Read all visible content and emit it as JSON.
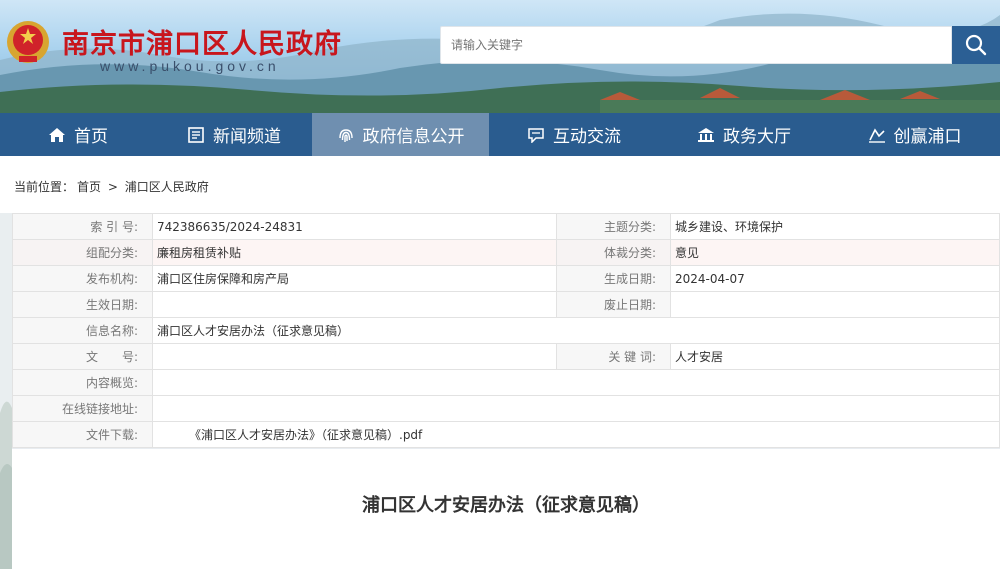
{
  "header": {
    "site_title": "南京市浦口区人民政府",
    "site_domain": "www.pukou.gov.cn",
    "search_placeholder": "请输入关键字"
  },
  "nav": {
    "items": [
      {
        "label": "首页",
        "icon": "home-icon"
      },
      {
        "label": "新闻频道",
        "icon": "news-icon"
      },
      {
        "label": "政府信息公开",
        "icon": "fingerprint-icon",
        "active": true
      },
      {
        "label": "互动交流",
        "icon": "chat-icon"
      },
      {
        "label": "政务大厅",
        "icon": "hall-icon"
      },
      {
        "label": "创赢浦口",
        "icon": "chart-icon"
      }
    ]
  },
  "breadcrumb": {
    "prefix": "当前位置：",
    "home": "首页",
    "sep": ">",
    "current": "浦口区人民政府"
  },
  "meta": {
    "index_no_label": "索 引 号:",
    "index_no": "742386635/2024-24831",
    "topic_label": "主题分类:",
    "topic": "城乡建设、环境保护",
    "group_label": "组配分类:",
    "group": "廉租房租赁补贴",
    "genre_label": "体裁分类:",
    "genre": "意见",
    "publisher_label": "发布机构:",
    "publisher": "浦口区住房保障和房产局",
    "created_label": "生成日期:",
    "created": "2024-04-07",
    "effective_label": "生效日期:",
    "effective": "",
    "abolished_label": "废止日期:",
    "abolished": "",
    "info_name_label": "信息名称:",
    "info_name": "浦口区人才安居办法（征求意见稿）",
    "doc_no_label": "文　　号:",
    "doc_no": "",
    "keywords_label": "关 键 词:",
    "keywords": "人才安居",
    "summary_label": "内容概览:",
    "summary": "",
    "link_label": "在线链接地址:",
    "link": "",
    "download_label": "文件下载:",
    "download": "《浦口区人才安居办法》（征求意见稿）.pdf"
  },
  "document": {
    "title": "浦口区人才安居办法（征求意见稿）"
  },
  "colors": {
    "nav_bg": "#2a5c8f",
    "nav_active": "#6f8fb0",
    "title_red": "#c8161d"
  }
}
